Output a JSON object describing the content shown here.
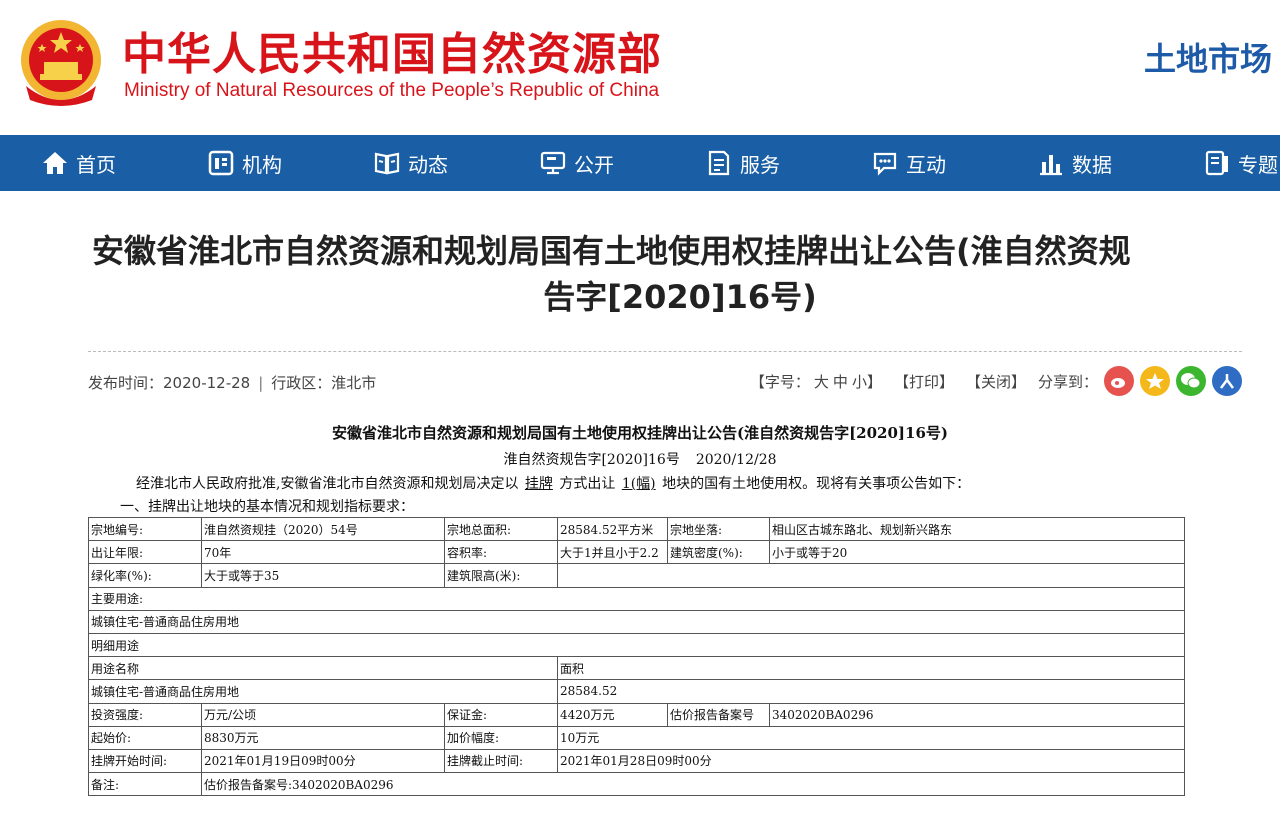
{
  "header": {
    "site_name_cn": "中华人民共和国自然资源部",
    "site_name_en": "Ministry of Natural Resources of the People’s Republic of China",
    "section_name": "土地市场"
  },
  "nav": {
    "items": [
      {
        "label": "首页",
        "icon": "home-icon"
      },
      {
        "label": "机构",
        "icon": "organization-icon"
      },
      {
        "label": "动态",
        "icon": "news-icon"
      },
      {
        "label": "公开",
        "icon": "disclosure-icon"
      },
      {
        "label": "服务",
        "icon": "service-icon"
      },
      {
        "label": "互动",
        "icon": "chat-icon"
      },
      {
        "label": "数据",
        "icon": "chart-icon"
      },
      {
        "label": "专题",
        "icon": "topic-icon"
      }
    ]
  },
  "article": {
    "title_line1": "安徽省淮北市自然资源和规划局国有土地使用权挂牌出让公告(淮自然资规",
    "title_line2": "告字[2020]16号)",
    "publish_label": "发布时间：",
    "publish_date": "2020-12-28",
    "region_label": "行政区：",
    "region": "淮北市",
    "font_label": "【字号：",
    "font_large": "大",
    "font_medium": "中",
    "font_small": "小】",
    "print_label": "【打印】",
    "close_label": "【关闭】",
    "share_label": "分享到：",
    "share_icons": [
      "weibo-icon",
      "qzone-icon",
      "wechat-icon",
      "renren-icon"
    ],
    "colors": {
      "weibo": "#e6534f",
      "qzone": "#f5b81b",
      "wechat": "#3db62f",
      "renren": "#2f6dc4"
    }
  },
  "doc": {
    "title": "安徽省淮北市自然资源和规划局国有土地使用权挂牌出让公告(淮自然资规告字[2020]16号)",
    "number": "淮自然资规告字[2020]16号",
    "date": "2020/12/28",
    "intro_a": "经淮北市人民政府批准,安徽省淮北市自然资源和规划局决定以",
    "intro_method": "挂牌",
    "intro_b": "方式出让",
    "intro_count": "1(幅)",
    "intro_c": "地块的国有土地使用权。现将有关事项公告如下：",
    "section1": "一、挂牌出让地块的基本情况和规划指标要求："
  },
  "table": {
    "plot_no_label": "宗地编号:",
    "plot_no": "淮自然资规挂（2020）54号",
    "area_label": "宗地总面积:",
    "area": "28584.52平方米",
    "location_label": "宗地坐落:",
    "location": "相山区古城东路北、规划新兴路东",
    "term_label": "出让年限:",
    "term": "70年",
    "far_label": "容积率:",
    "far": "大于1并且小于2.2",
    "density_label": "建筑密度(%):",
    "density": "小于或等于20",
    "green_label": "绿化率(%):",
    "green": "大于或等于35",
    "height_label": "建筑限高(米):",
    "height": "",
    "use_label": "主要用途:",
    "use": "城镇住宅-普通商品住房用地",
    "detail_label": "明细用途",
    "use_name_label": "用途名称",
    "use_area_label": "面积",
    "use_name": "城镇住宅-普通商品住房用地",
    "use_area": "28584.52",
    "invest_label": "投资强度:",
    "invest": "万元/公顷",
    "deposit_label": "保证金:",
    "deposit": "4420万元",
    "appraisal_label": "估价报告备案号",
    "appraisal": "3402020BA0296",
    "start_price_label": "起始价:",
    "start_price": "8830万元",
    "increment_label": "加价幅度:",
    "increment": "10万元",
    "start_time_label": "挂牌开始时间:",
    "start_time": "2021年01月19日09时00分",
    "end_time_label": "挂牌截止时间:",
    "end_time": "2021年01月28日09时00分",
    "remark_label": "备注:",
    "remark": "估价报告备案号:3402020BA0296"
  }
}
